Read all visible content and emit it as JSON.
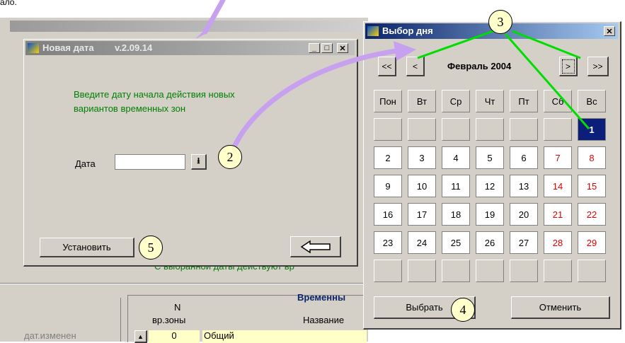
{
  "top_text": "ало.",
  "back_window": {
    "green_label": "С выбранной даты действуют вр",
    "table_title": "Временны",
    "col_n": "N",
    "col_zone": "вр.зоны",
    "col_name": "Название",
    "left_label": "дат.изменен",
    "row_num": "0",
    "row_name": "Общий"
  },
  "new_date_dialog": {
    "title": "Новая дата",
    "version": "v.2.09.14",
    "instruction_line1": "Введите  дату начала действия новых",
    "instruction_line2": "вариантов временных зон",
    "date_label": "Дата",
    "date_value": "",
    "set_button": "Установить"
  },
  "day_picker": {
    "title": "Выбор дня",
    "month_label": "Февраль 2004",
    "nav_prev_year": "<<",
    "nav_prev": "<",
    "nav_next": ">",
    "nav_next_year": ">>",
    "weekdays": [
      "Пон",
      "Вт",
      "Ср",
      "Чт",
      "Пт",
      "Сб",
      "Вс"
    ],
    "weeks": [
      [
        "",
        "",
        "",
        "",
        "",
        "",
        "1"
      ],
      [
        "2",
        "3",
        "4",
        "5",
        "6",
        "7",
        "8"
      ],
      [
        "9",
        "10",
        "11",
        "12",
        "13",
        "14",
        "15"
      ],
      [
        "16",
        "17",
        "18",
        "19",
        "20",
        "21",
        "22"
      ],
      [
        "23",
        "24",
        "25",
        "26",
        "27",
        "28",
        "29"
      ],
      [
        "",
        "",
        "",
        "",
        "",
        "",
        ""
      ]
    ],
    "select_button": "Выбрать",
    "cancel_button": "Отменить"
  },
  "callouts": [
    "2",
    "3",
    "4",
    "5"
  ],
  "colors": {
    "accent_green": "#008000",
    "weekend_red": "#e00000",
    "selected_bg": "#0a1e7a",
    "arrow_purple": "#c8a0f0",
    "line_green": "#00dd00"
  }
}
